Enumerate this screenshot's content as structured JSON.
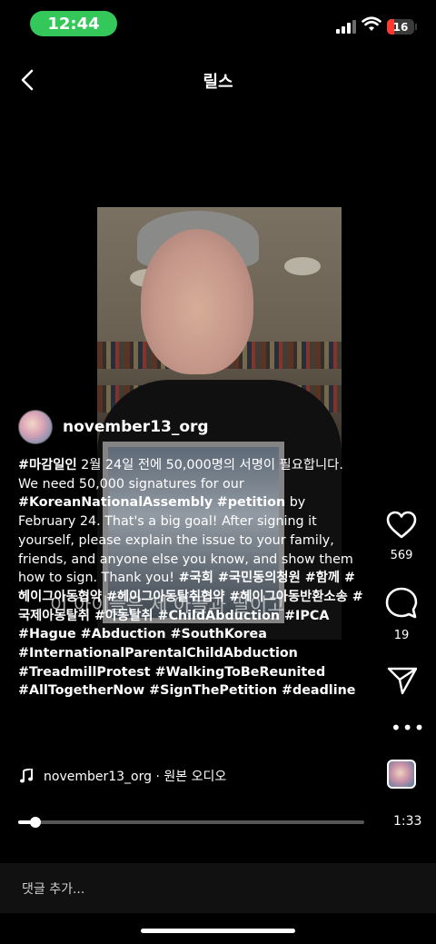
{
  "status_bar": {
    "time": "12:44",
    "battery": "16"
  },
  "header": {
    "title": "릴스",
    "back_icon": "chevron-left-icon"
  },
  "video": {
    "overlay_caption": "이 아이들은 제 아들과 딸이고"
  },
  "author": {
    "username": "november13_org"
  },
  "caption": {
    "segments": [
      {
        "text": "#마감일인",
        "tag": true
      },
      {
        "text": " 2월 24일 전에 50,000명의 서명이 필요합니다. We need 50,000 signatures for our ",
        "tag": false
      },
      {
        "text": "#KoreanNationalAssembly",
        "tag": true
      },
      {
        "text": " ",
        "tag": false
      },
      {
        "text": "#petition",
        "tag": true
      },
      {
        "text": " by February 24. That's a big goal! After signing it yourself, please explain the issue to your family, friends, and anyone else you know, and show them how to sign. Thank you! ",
        "tag": false
      },
      {
        "text": "#국회 #국민동의청원 #함께 #헤이그아동협약 #헤이그아동탈취협약 #헤이그아동반환소송 #국제아동탈취 #아동탈취 #ChildAbduction #IPCA #Hague #Abduction #SouthKorea #InternationalParentalChildAbduction #TreadmillProtest #WalkingToBeReunited #AllTogetherNow #SignThePetition #deadline",
        "tag": true
      }
    ]
  },
  "actions": {
    "like_count": "569",
    "comment_count": "19"
  },
  "audio": {
    "label": "november13_org · 원본 오디오"
  },
  "player": {
    "duration": "1:33",
    "progress": 0.05
  },
  "comment": {
    "placeholder": "댓글 추가..."
  }
}
